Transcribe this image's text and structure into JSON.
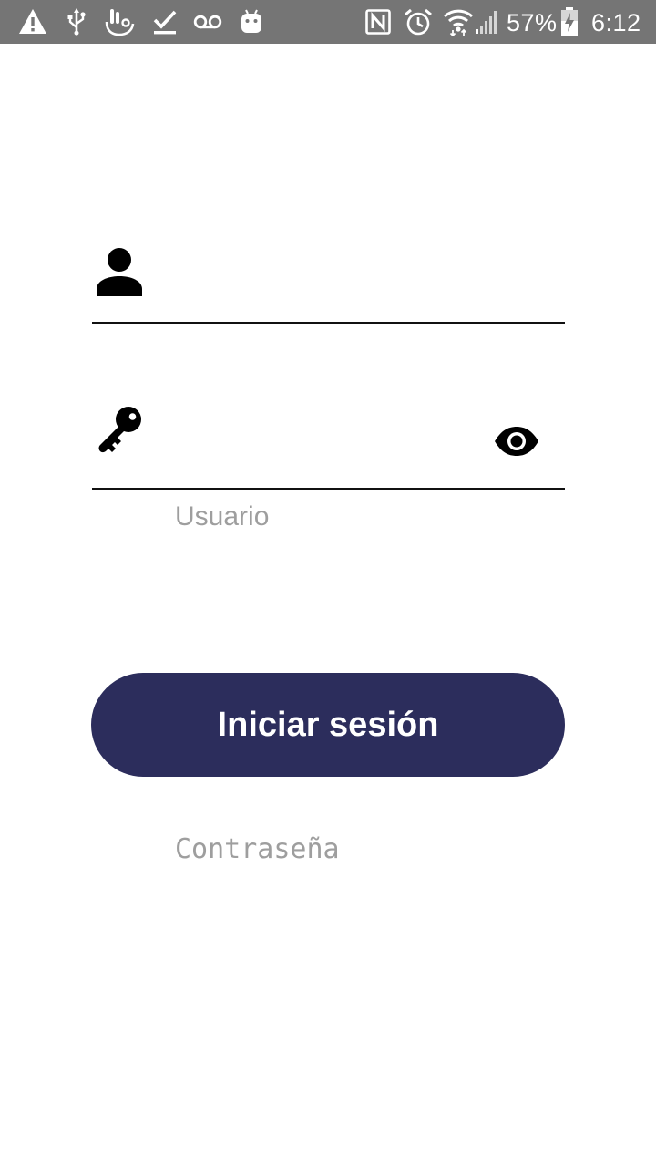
{
  "status_bar": {
    "battery_percent": "57%",
    "time": "6:12",
    "icons_left": [
      "warning-icon",
      "usb-icon",
      "touch-gesture-icon",
      "check-icon",
      "voicemail-icon",
      "android-icon"
    ],
    "icons_right": [
      "nfc-icon",
      "alarm-icon",
      "wifi-icon",
      "signal-icon",
      "battery-charging-icon"
    ],
    "background": "#757575"
  },
  "login_form": {
    "username": {
      "placeholder": "Usuario",
      "value": "",
      "icon": "person-icon"
    },
    "password": {
      "placeholder": "Contraseña",
      "value": "",
      "icon": "key-icon",
      "toggle_icon": "eye-icon"
    },
    "submit_label": "Iniciar sesión",
    "button_color": "#2c2d5c"
  }
}
